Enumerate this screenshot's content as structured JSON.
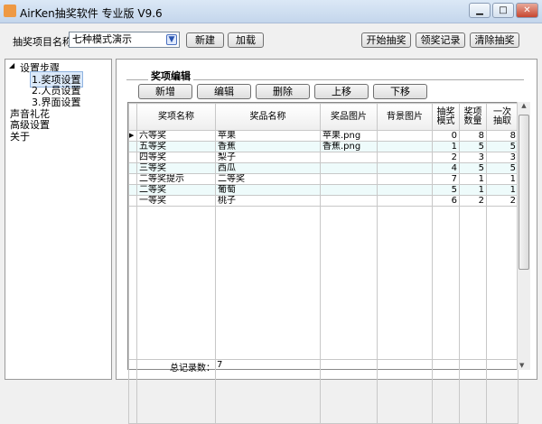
{
  "window": {
    "title": "AirKen抽奖软件 专业版 V9.6",
    "min": "▁",
    "max": "□",
    "close": "✕"
  },
  "toolbar": {
    "project_label": "抽奖项目名称",
    "project_value": "七种模式演示",
    "new": "新建",
    "load": "加载",
    "start": "开始抽奖",
    "records": "领奖记录",
    "clear": "清除抽奖"
  },
  "tree": {
    "root": "设置步骤",
    "items": [
      "1.奖项设置",
      "2.人员设置",
      "3.界面设置"
    ],
    "others": [
      "声音礼花",
      "高级设置",
      "关于"
    ]
  },
  "editor": {
    "group": "奖项编辑",
    "buttons": [
      "新增",
      "编辑",
      "删除",
      "上移",
      "下移"
    ]
  },
  "grid": {
    "columns": [
      "奖项名称",
      "奖品名称",
      "奖品图片",
      "背景图片",
      "抽奖模式",
      "奖项数量",
      "一次抽取"
    ],
    "rows": [
      [
        "六等奖",
        "苹果",
        "苹果.png",
        "",
        "0",
        "8",
        "8"
      ],
      [
        "五等奖",
        "香蕉",
        "香蕉.png",
        "",
        "1",
        "5",
        "5"
      ],
      [
        "四等奖",
        "梨子",
        "",
        "",
        "2",
        "3",
        "3"
      ],
      [
        "三等奖",
        "西瓜",
        "",
        "",
        "4",
        "5",
        "5"
      ],
      [
        "二等奖提示",
        "二等奖",
        "",
        "",
        "7",
        "1",
        "1"
      ],
      [
        "二等奖",
        "葡萄",
        "",
        "",
        "5",
        "1",
        "1"
      ],
      [
        "一等奖",
        "桃子",
        "",
        "",
        "6",
        "2",
        "2"
      ]
    ],
    "footer_label": "总记录数：",
    "footer_value": "7"
  }
}
